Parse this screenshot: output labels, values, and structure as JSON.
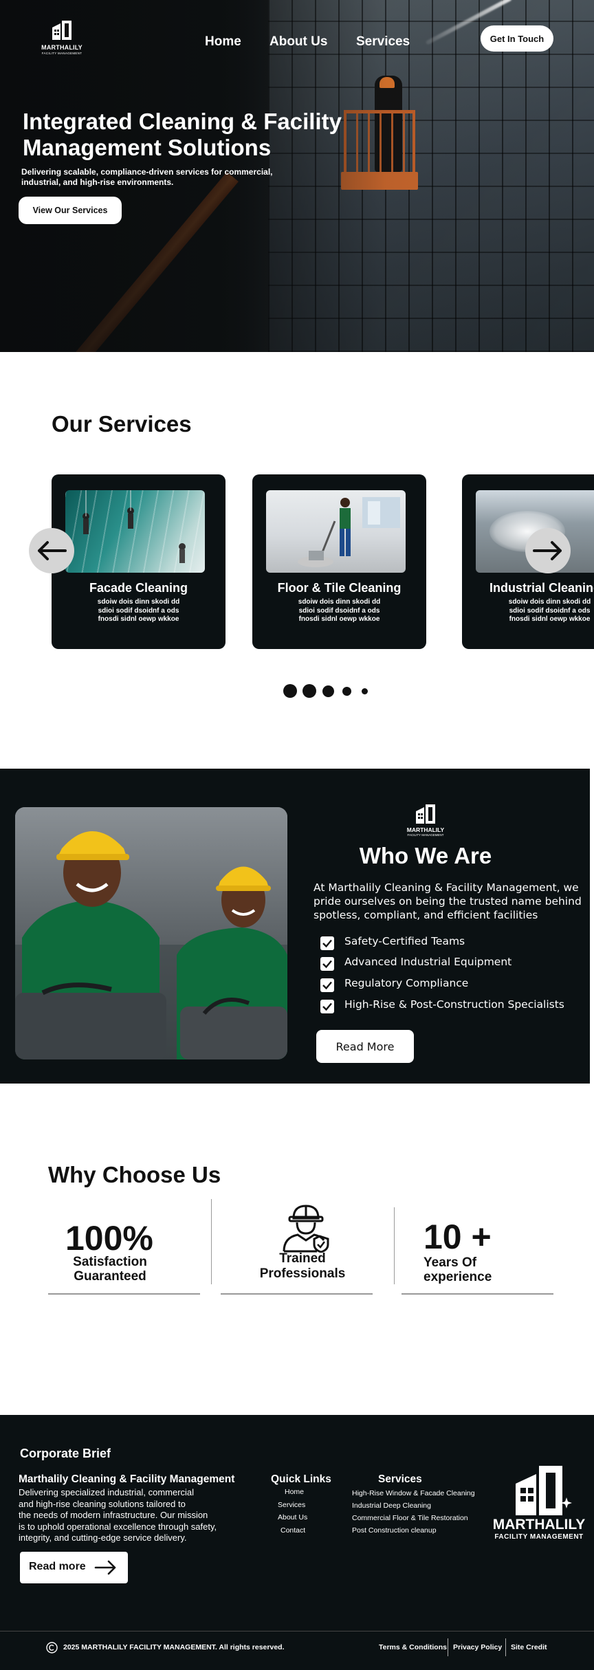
{
  "brand": {
    "name": "MARTHALILY",
    "tagline": "FACILITY MANAGEMENT"
  },
  "nav": {
    "items": [
      "Home",
      "About Us",
      "Services"
    ],
    "cta": "Get In Touch"
  },
  "hero": {
    "title": "Integrated Cleaning & Facility Management Solutions",
    "subtitle": "Delivering scalable, compliance-driven services for commercial, industrial, and high-rise environments.",
    "button": "View Our Services"
  },
  "services": {
    "title": "Our Services",
    "cards": [
      {
        "title": "Facade Cleaning",
        "desc": "sdoiw dois dinn skodi dd sdioi sodif dsoidnf a ods fnosdi sidnl oewp wkkoe"
      },
      {
        "title": "Floor & Tile Cleaning",
        "desc": "sdoiw dois dinn skodi dd sdioi sodif dsoidnf a ods fnosdi sidnl oewp wkkoe"
      },
      {
        "title": "Industrial Cleaning",
        "desc": "sdoiw dois dinn skodi dd sdioi sodif dsoidnf a ods fnosdi sidnl oewp wkkoe"
      }
    ],
    "prev_icon": "arrow-left-icon",
    "next_icon": "arrow-right-icon",
    "pagination_count": 5
  },
  "about": {
    "title": "Who We Are",
    "text": "At Marthalily Cleaning & Facility Management, we pride ourselves on being the trusted name behind spotless, compliant, and efficient facilities",
    "checks": [
      "Safety-Certified Teams",
      "Advanced Industrial Equipment",
      "Regulatory Compliance",
      "High-Rise & Post-Construction Specialists"
    ],
    "button": "Read More"
  },
  "why": {
    "title": "Why Choose Us",
    "stats": [
      {
        "big": "100%",
        "label_line1": "Satisfaction",
        "label_line2": "Guaranteed"
      },
      {
        "icon": "worker-shield-icon",
        "label_line1": "Trained",
        "label_line2": "Professionals"
      },
      {
        "big": "10 +",
        "label_line1": "Years Of",
        "label_line2": "experience"
      }
    ]
  },
  "footer": {
    "heading": "Corporate Brief",
    "company": "Marthalily Cleaning & Facility Management",
    "description_lines": [
      "Delivering specialized industrial, commercial",
      "and high-rise cleaning solutions tailored to",
      "the needs of modern infrastructure. Our mission",
      "is to uphold operational excellence through safety,",
      "integrity, and cutting-edge service delivery."
    ],
    "read_more": "Read more",
    "quick_links_title": "Quick Links",
    "quick_links": [
      "Home",
      "Services",
      "About Us",
      "Contact"
    ],
    "services_title": "Services",
    "services": [
      "High-Rise Window & Facade Cleaning",
      "Industrial Deep Cleaning",
      "Commercial Floor & Tile Restoration",
      "Post Construction cleanup"
    ],
    "copyright": "2025 MARTHALILY FACILITY MANAGEMENT. All rights reserved.",
    "legal_links": [
      "Terms & Conditions",
      "Privacy Policy",
      "Site Credit"
    ]
  }
}
